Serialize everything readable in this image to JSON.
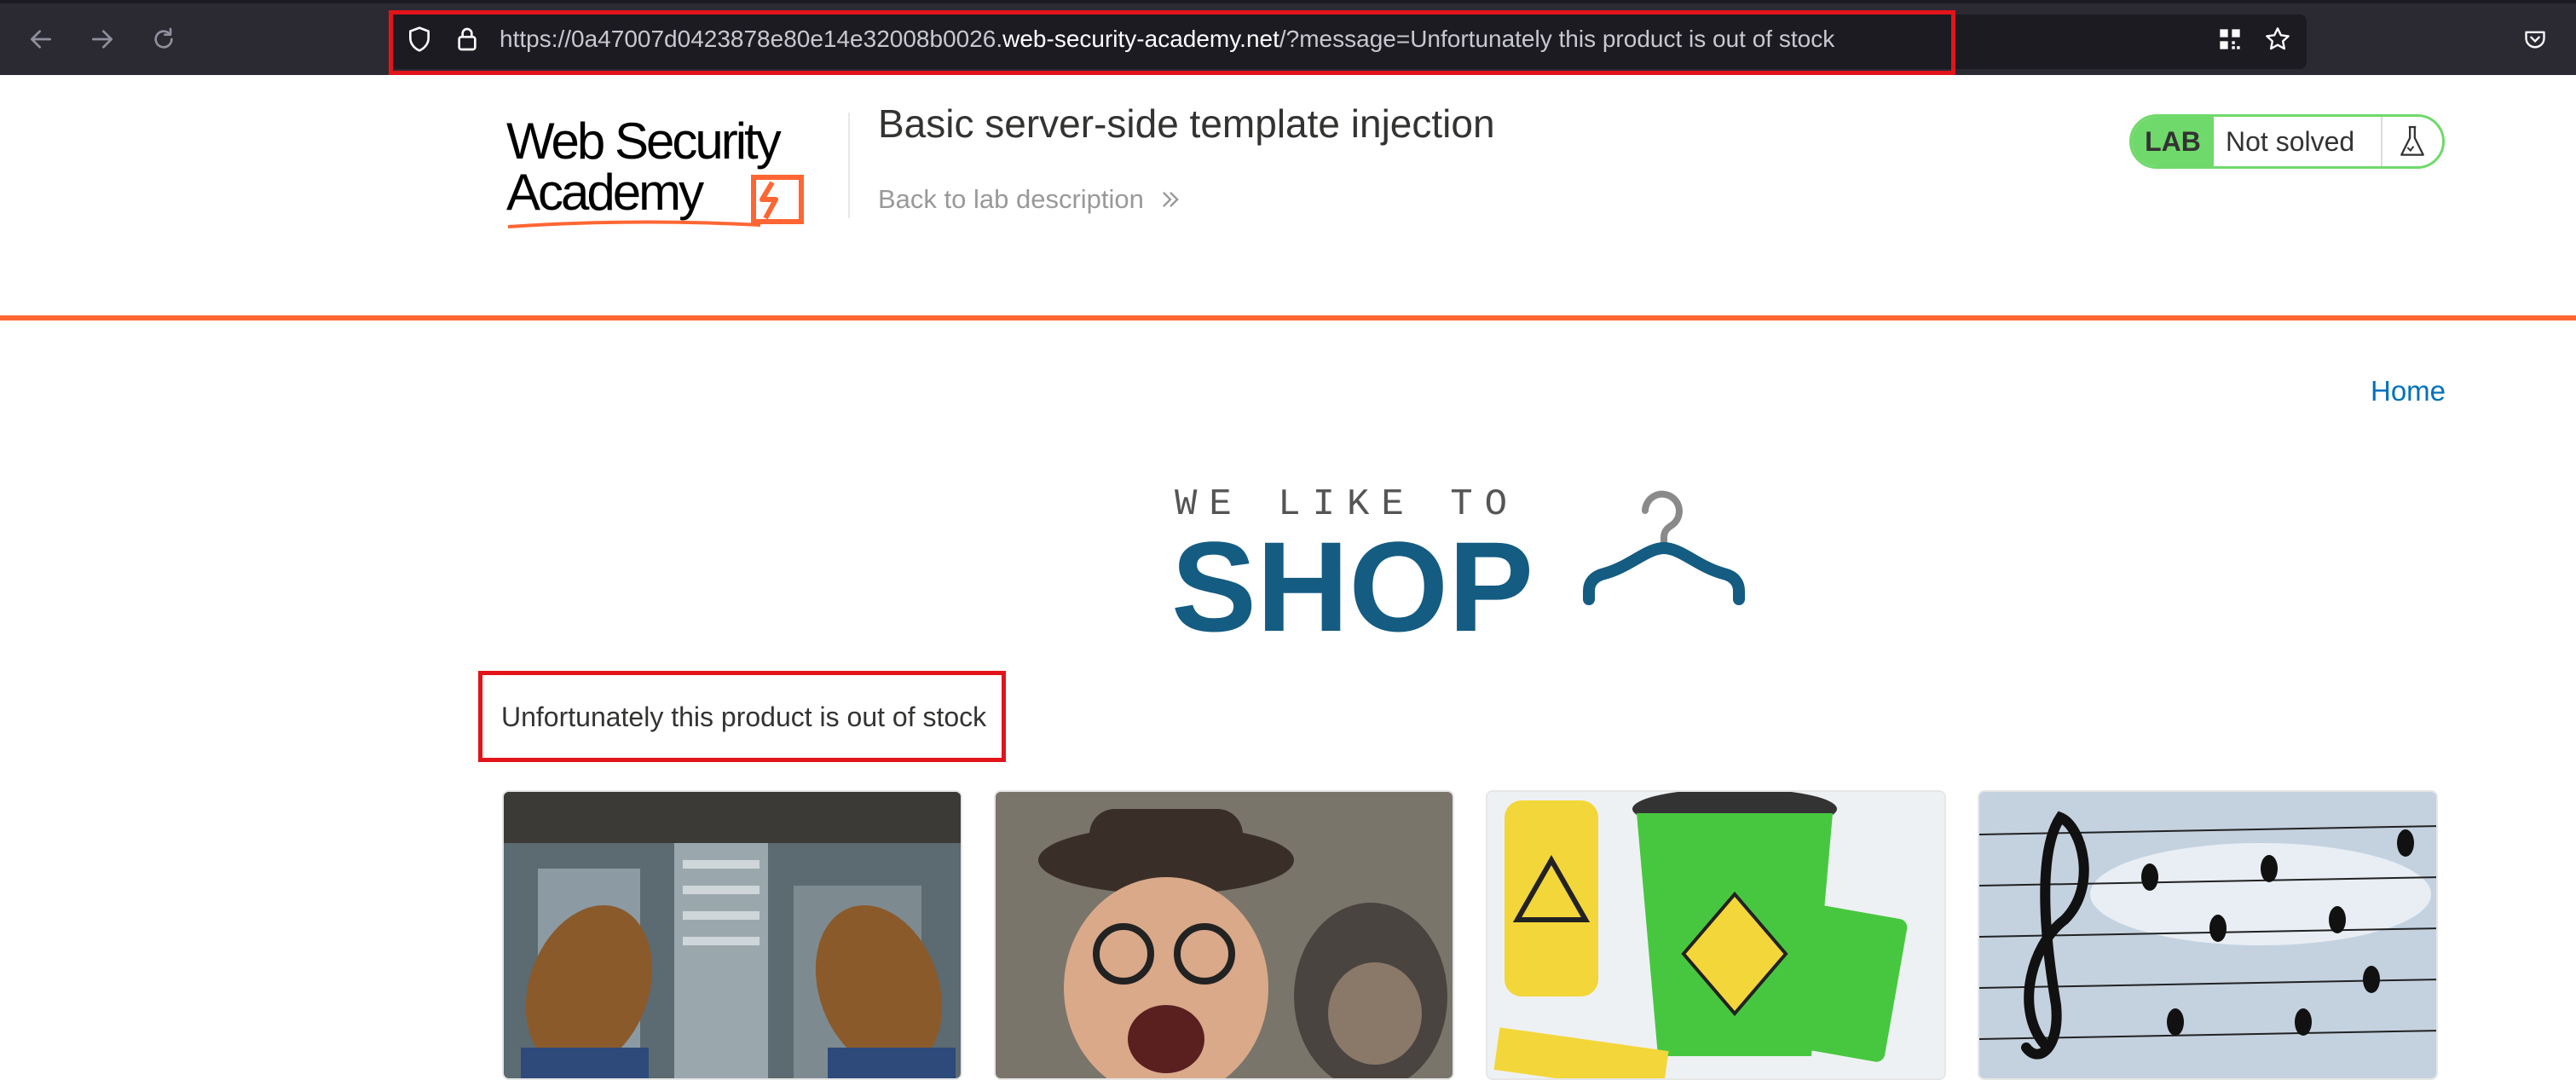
{
  "browser": {
    "url_prefix": "https://0a47007d0423878e80e14e32008b0026.",
    "url_host": "web-security-academy.net",
    "url_suffix": "/?message=Unfortunately this product is out of stock",
    "icons": [
      "back-arrow-icon",
      "forward-arrow-icon",
      "reload-icon",
      "shield-icon",
      "lock-icon",
      "qr-code-icon",
      "bookmark-star-icon",
      "pocket-icon"
    ]
  },
  "lab_header": {
    "logo_line1": "Web Security",
    "logo_line2": "Academy",
    "title": "Basic server-side template injection",
    "back_link": "Back to lab description",
    "back_link_icon": "double-chevron-right-icon",
    "lab_badge": "LAB",
    "lab_status": "Not solved",
    "status_icon": "flask-icon"
  },
  "nav": {
    "home_link": "Home"
  },
  "shop_logo": {
    "tagline": "WE LIKE TO",
    "word": "SHOP",
    "icon": "hanger-icon"
  },
  "message": "Unfortunately this product is out of stock",
  "products": [
    {
      "image": "feet-over-city-image"
    },
    {
      "image": "man-and-monkey-image"
    },
    {
      "image": "bucket-of-doom-image"
    },
    {
      "image": "birds-on-wires-music-image"
    }
  ],
  "colors": {
    "accent_orange": "#ff6633",
    "lab_green": "#70d96b",
    "link_blue": "#0071bc",
    "shop_blue": "#145c82",
    "highlight_red": "#e2141a"
  }
}
